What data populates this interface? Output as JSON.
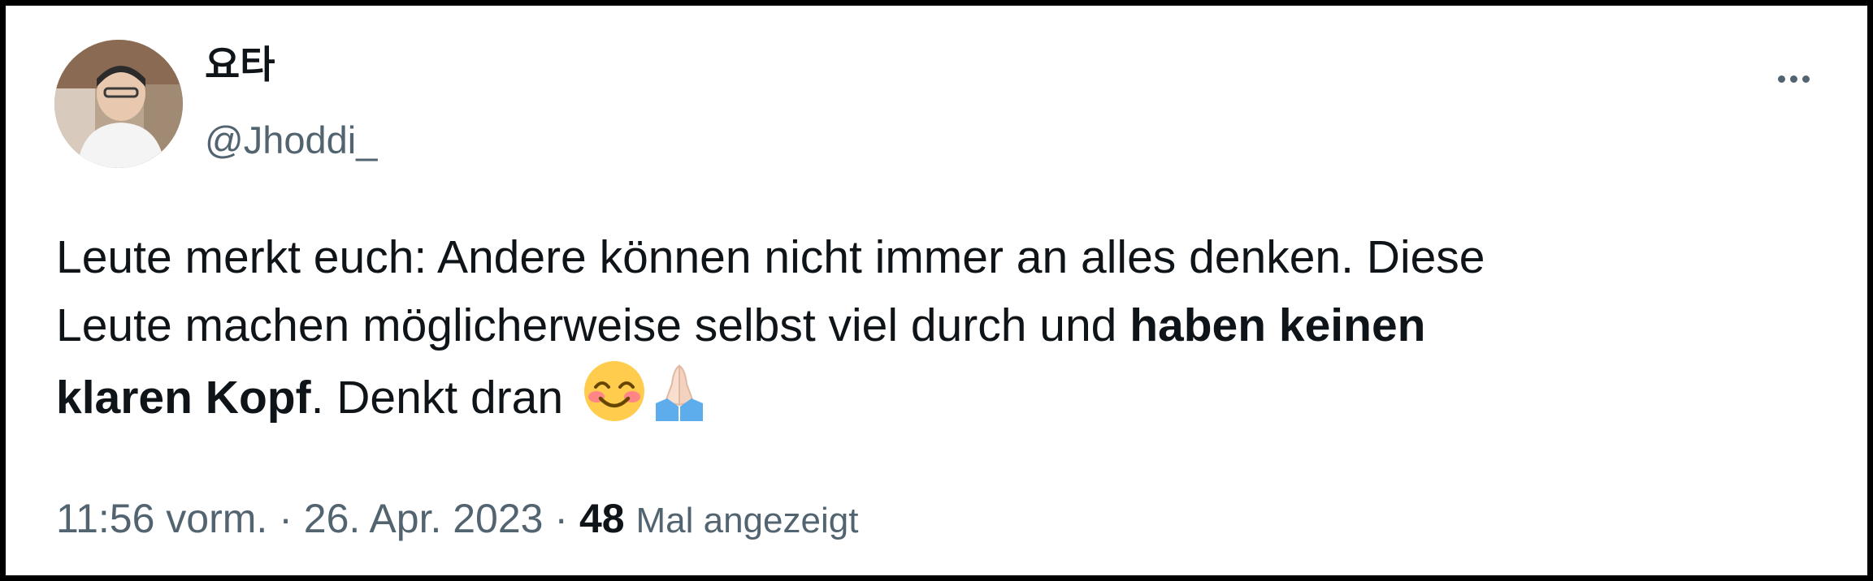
{
  "tweet": {
    "author": {
      "display_name": "요타",
      "handle": "@Jhoddi_",
      "avatar_icon": "profile-photo"
    },
    "more_icon": "more-horizontal-icon",
    "text": {
      "line1": "Leute merkt euch: Andere können nicht immer an alles denken. Diese",
      "line2_plain": "Leute machen möglicherweise selbst viel durch und ",
      "line2_bold": "haben keinen",
      "line3_bold": "klaren Kopf",
      "line3_plain": ". Denkt dran",
      "emojis": [
        "smiling-face-with-smiling-eyes",
        "folded-hands"
      ]
    },
    "meta": {
      "time": "11:56 vorm.",
      "separator": "·",
      "date": "26. Apr. 2023",
      "separator2": "·",
      "views_count": "48",
      "views_label": "Mal angezeigt"
    }
  },
  "colors": {
    "text_primary": "#0f1419",
    "text_secondary": "#536471",
    "frame_border": "#000000"
  }
}
